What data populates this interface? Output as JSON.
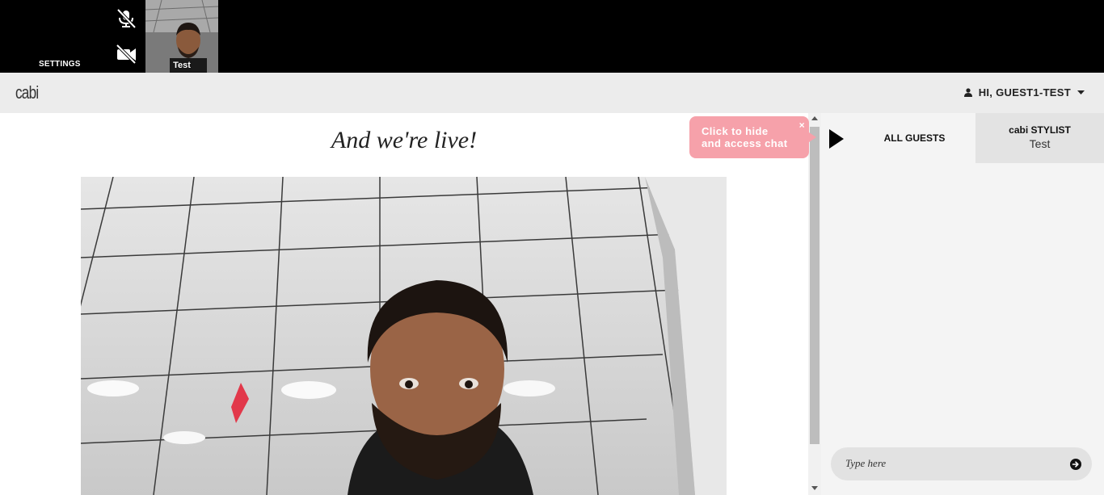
{
  "topbar": {
    "settings_label": "SETTINGS",
    "mic_icon": "mic-muted-icon",
    "camera_icon": "camera-off-icon",
    "participant_name": "Test"
  },
  "header": {
    "logo": "cabi",
    "greeting": "HI, GUEST1-TEST"
  },
  "main": {
    "title": "And we're live!"
  },
  "tooltip": {
    "line1": "Click to hide",
    "line2": "and access chat",
    "close": "×"
  },
  "chat": {
    "tab_all": "ALL GUESTS",
    "tab_stylist_title": "cabi STYLIST",
    "tab_stylist_name": "Test",
    "input_placeholder": "Type here"
  },
  "colors": {
    "tooltip": "#f6a1aa",
    "header_bg": "#ececec",
    "chat_bg": "#f4f4f4"
  }
}
